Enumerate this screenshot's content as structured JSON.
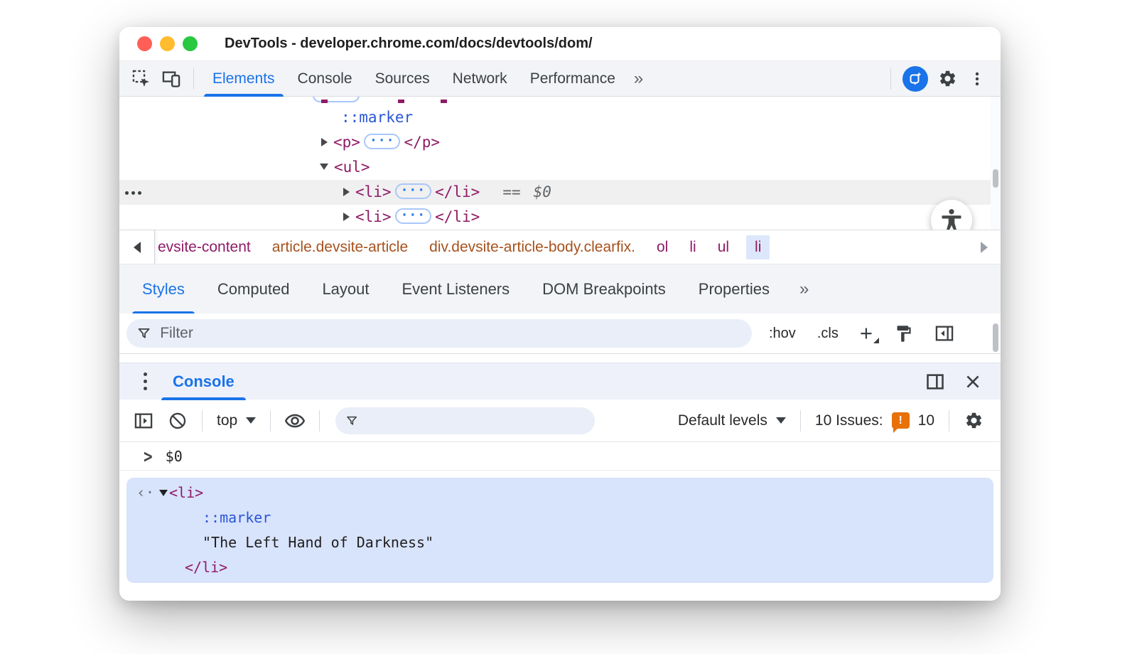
{
  "window": {
    "title": "DevTools - developer.chrome.com/docs/devtools/dom/"
  },
  "main_toolbar": {
    "tabs": [
      {
        "label": "Elements"
      },
      {
        "label": "Console"
      },
      {
        "label": "Sources"
      },
      {
        "label": "Network"
      },
      {
        "label": "Performance"
      }
    ],
    "overflow": "»"
  },
  "elements_tree": {
    "marker": "::marker",
    "p_open": "<p>",
    "p_close": "</p>",
    "ul_open": "<ul>",
    "li_open": "<li>",
    "li_close": "</li>",
    "ellipsis": "···",
    "equals": "==",
    "dollar": "$0"
  },
  "breadcrumb": {
    "items": [
      {
        "label": "evsite-content"
      },
      {
        "label": "article.devsite-article"
      },
      {
        "label": "div.devsite-article-body.clearfix."
      },
      {
        "label": "ol"
      },
      {
        "label": "li"
      },
      {
        "label": "ul"
      },
      {
        "label": "li"
      }
    ]
  },
  "sidebar_tabs": {
    "tabs": [
      "Styles",
      "Computed",
      "Layout",
      "Event Listeners",
      "DOM Breakpoints",
      "Properties"
    ],
    "overflow": "»"
  },
  "styles_filter": {
    "placeholder": "Filter",
    "hov": ":hov",
    "cls": ".cls",
    "plus": "+"
  },
  "console_drawer": {
    "tab": "Console"
  },
  "console_toolbar": {
    "context": "top",
    "levels": "Default levels",
    "issues_label": "10 Issues:",
    "issues_glyph": "!",
    "issues_count": "10"
  },
  "console_output": {
    "prompt_glyph": ">",
    "prompt_expr": "$0",
    "result": {
      "return_marker": "‹·",
      "li_open": "<li>",
      "marker": "::marker",
      "text": "\"The Left Hand of Darkness\"",
      "li_close": "</li>"
    }
  },
  "colors": {
    "accent": "#1a73e8",
    "tag": "#8f1b66",
    "pseudo_blue": "#2a56d6",
    "breadcrumb_class": "#a6521d",
    "issues_orange": "#e8710a",
    "result_highlight": "#d8e3fc"
  }
}
